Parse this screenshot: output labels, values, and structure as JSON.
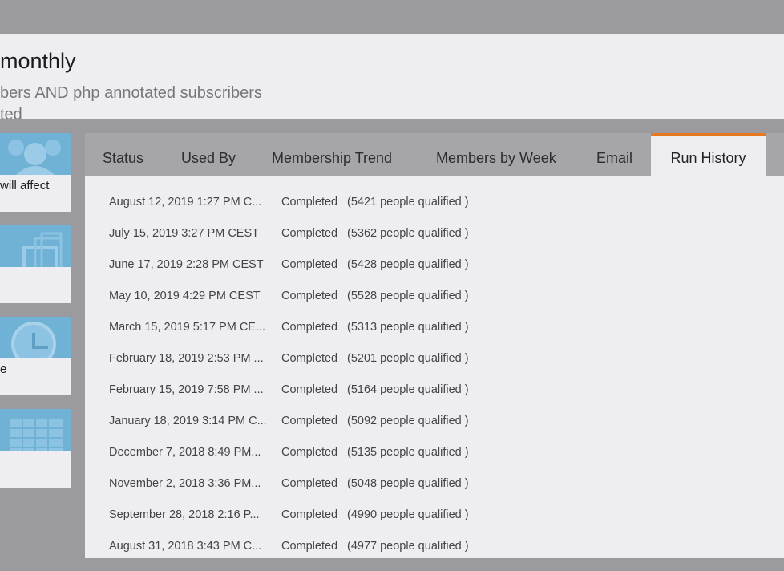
{
  "header": {
    "title": "monthly",
    "subtitle": "bers AND php annotated subscribers",
    "subtitle2": "ted"
  },
  "cards": [
    {
      "label": "will affect",
      "icon": "people-icon"
    },
    {
      "label": "",
      "icon": "stacked-layers-icon"
    },
    {
      "label": "e",
      "icon": "clock-icon"
    },
    {
      "label": "",
      "icon": "calendar-grid-icon"
    }
  ],
  "tabs": [
    {
      "label": "Status"
    },
    {
      "label": "Used By"
    },
    {
      "label": "Membership Trend"
    },
    {
      "label": "Members by Week"
    },
    {
      "label": "Email"
    },
    {
      "label": "Run History",
      "active": true
    }
  ],
  "run_history": [
    {
      "date": "August 12, 2019 1:27 PM C...",
      "status": "Completed",
      "qualified": "(5421 people qualified )"
    },
    {
      "date": "July 15, 2019 3:27 PM CEST",
      "status": "Completed",
      "qualified": "(5362 people qualified )"
    },
    {
      "date": "June 17, 2019 2:28 PM CEST",
      "status": "Completed",
      "qualified": "(5428 people qualified )"
    },
    {
      "date": "May 10, 2019 4:29 PM CEST",
      "status": "Completed",
      "qualified": "(5528 people qualified )"
    },
    {
      "date": "March 15, 2019 5:17 PM CE...",
      "status": "Completed",
      "qualified": "(5313 people qualified )"
    },
    {
      "date": "February 18, 2019 2:53 PM ...",
      "status": "Completed",
      "qualified": "(5201 people qualified )"
    },
    {
      "date": "February 15, 2019 7:58 PM ...",
      "status": "Completed",
      "qualified": "(5164 people qualified )"
    },
    {
      "date": "January 18, 2019 3:14 PM C...",
      "status": "Completed",
      "qualified": "(5092 people qualified )"
    },
    {
      "date": "December 7, 2018 8:49 PM...",
      "status": "Completed",
      "qualified": "(5135 people qualified )"
    },
    {
      "date": "November 2, 2018 3:36 PM...",
      "status": "Completed",
      "qualified": "(5048 people qualified )"
    },
    {
      "date": "September 28, 2018 2:16 P...",
      "status": "Completed",
      "qualified": "(4990 people qualified )"
    },
    {
      "date": "August 31, 2018 3:43 PM C...",
      "status": "Completed",
      "qualified": "(4977 people qualified )"
    }
  ],
  "colors": {
    "accent": "#e57a22",
    "card_image": "#6fb2d6",
    "overlay": "#9b9a9f",
    "panel": "#eeedf2"
  }
}
